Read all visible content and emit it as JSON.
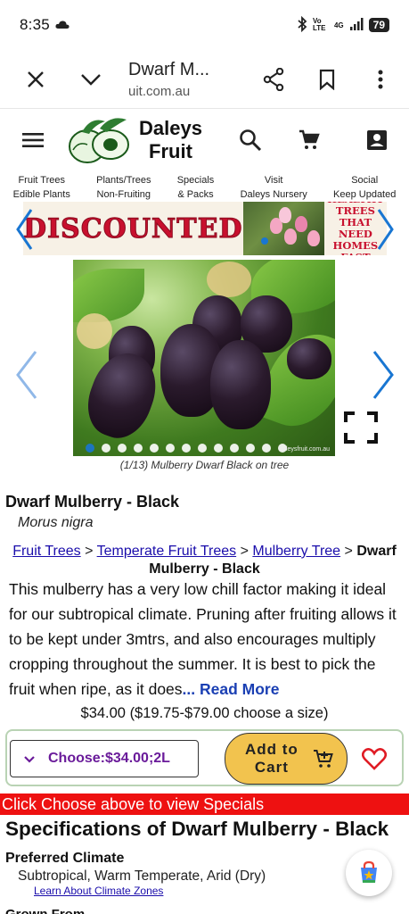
{
  "status_bar": {
    "time": "8:35",
    "network": "4G",
    "volte": "Vo LTE",
    "battery": "79"
  },
  "toolbar": {
    "title": "Dwarf M...",
    "url": "uit.com.au"
  },
  "site": {
    "logo_line1": "Daleys",
    "logo_line2": "Fruit"
  },
  "nav": [
    {
      "line1": "Fruit Trees",
      "line2": "Edible Plants"
    },
    {
      "line1": "Plants/Trees",
      "line2": "Non-Fruiting"
    },
    {
      "line1": "Specials",
      "line2": "& Packs"
    },
    {
      "line1": "Visit",
      "line2": "Daleys Nursery"
    },
    {
      "line1": "Social",
      "line2": "Keep Updated"
    }
  ],
  "banner": {
    "left_text": "DISCOUNTED",
    "right_line1": "HEALTHY TREES",
    "right_line2": "THAT NEED",
    "right_line3": "HOMES FAST"
  },
  "gallery": {
    "caption": "(1/13) Mulberry Dwarf Black on tree",
    "watermark": "daleysfruit.com.au",
    "total": 13,
    "active_index": 0
  },
  "product": {
    "title": "Dwarf Mulberry - Black",
    "latin": "Morus nigra",
    "breadcrumb": {
      "crumb1": "Fruit Trees",
      "crumb2": "Temperate Fruit Trees",
      "crumb3": "Mulberry Tree",
      "current": "Dwarf Mulberry - Black",
      "separator": ">"
    },
    "description": "This mulberry has a very low chill factor making it ideal for our subtropical climate. Pruning after fruiting allows it to be kept under 3mtrs, and also encourages multiply cropping throughout the summer. It is best to pick the fruit when ripe, as it does",
    "read_more": "... Read More",
    "price_line": "$34.00 ($19.75-$79.00 choose a size)"
  },
  "buy": {
    "choose_label": "Choose:$34.00;2L",
    "cart_line1": "Add to",
    "cart_line2": "Cart"
  },
  "specials_bar": "Click Choose above to view Specials",
  "specs": {
    "title": "Specifications of Dwarf Mulberry - Black",
    "climate_label": "Preferred Climate",
    "climate_value": "Subtropical, Warm Temperate, Arid (Dry)",
    "climate_link": "Learn About Climate Zones",
    "next_label": "Grown From"
  },
  "colors": {
    "accent_blue": "#1976d2",
    "link": "#1a0dab",
    "cart_yellow": "#f2c34e",
    "specials_red": "#ee1111",
    "choose_purple": "#6a1b9a"
  }
}
